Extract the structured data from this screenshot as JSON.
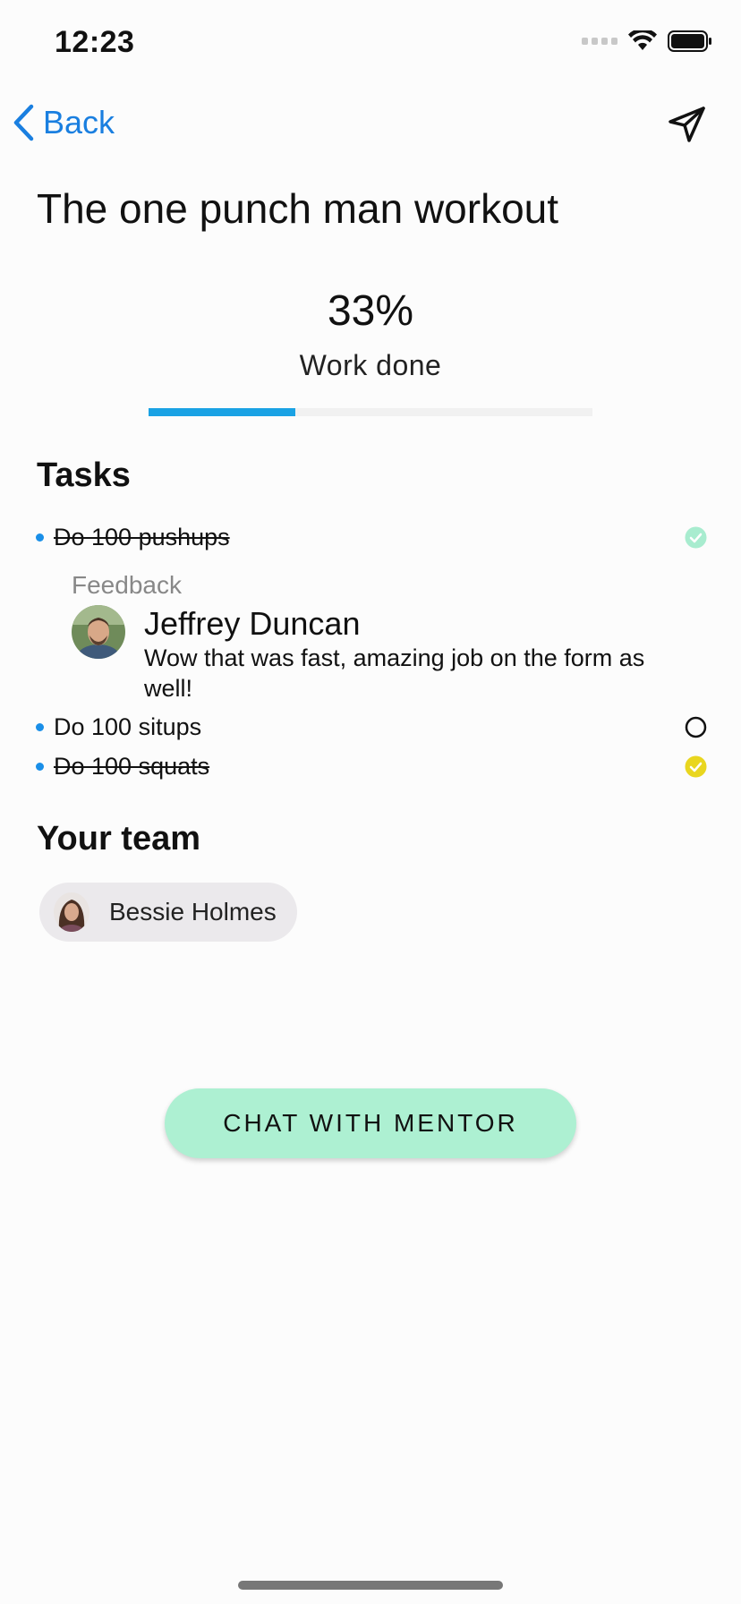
{
  "status_bar": {
    "time": "12:23"
  },
  "nav": {
    "back_label": "Back"
  },
  "page": {
    "title": "The one punch man workout"
  },
  "progress": {
    "percent_text": "33%",
    "label": "Work done",
    "value": 0.33
  },
  "tasks_section": {
    "title": "Tasks",
    "tasks": [
      {
        "label": "Do 100 pushups",
        "done": true,
        "status_color": "#a8eccf"
      },
      {
        "label": "Do 100 situps",
        "done": false,
        "status_color": "#111111"
      },
      {
        "label": "Do 100 squats",
        "done": true,
        "status_color": "#e9d61f"
      }
    ],
    "feedback": {
      "heading": "Feedback",
      "author": "Jeffrey Duncan",
      "text": "Wow that was fast, amazing job on the form as well!"
    }
  },
  "team_section": {
    "title": "Your team",
    "members": [
      {
        "name": "Bessie Holmes"
      }
    ]
  },
  "chat_button": {
    "label": "CHAT WITH MENTOR"
  },
  "colors": {
    "accent": "#1a7fe0",
    "progress": "#1aa2e4",
    "button": "#adf0d2"
  }
}
